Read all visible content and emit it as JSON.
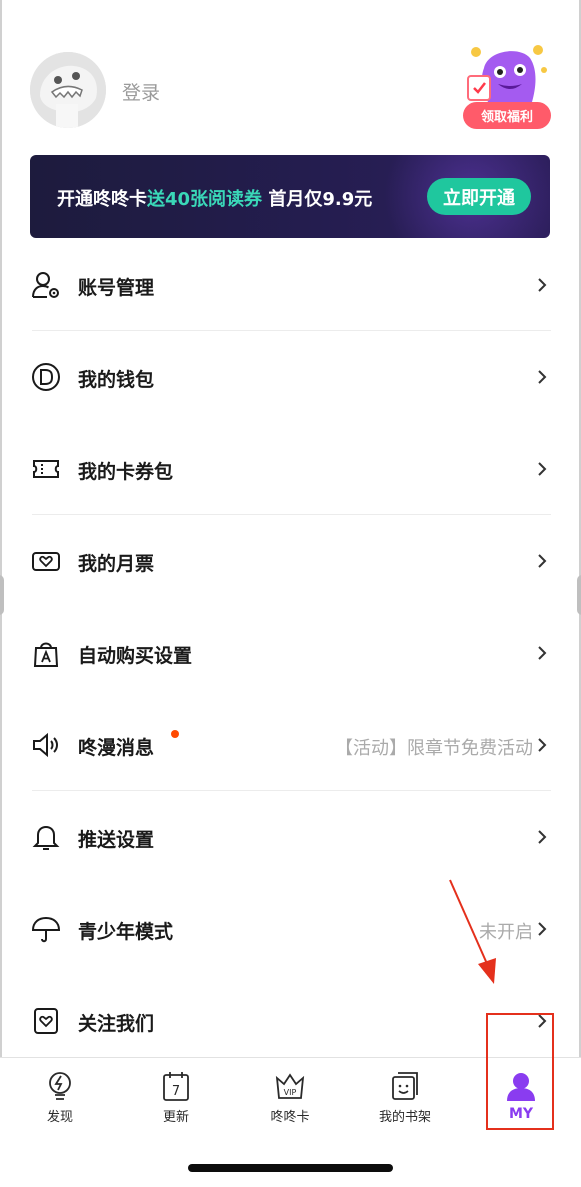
{
  "header": {
    "login_label": "登录",
    "benefit_label": "领取福利"
  },
  "banner": {
    "text_prefix": "开通咚咚卡",
    "text_highlight": "送40张阅读券",
    "text_suffix": " 首月仅9.9元",
    "cta_label": "立即开通",
    "accent_color": "#3ad8b8",
    "button_color": "#1fc79e"
  },
  "menu": {
    "items": [
      {
        "label": "账号管理",
        "icon": "account-settings-icon"
      },
      {
        "label": "我的钱包",
        "icon": "wallet-icon"
      },
      {
        "label": "我的卡券包",
        "icon": "ticket-icon"
      },
      {
        "label": "我的月票",
        "icon": "monthly-ticket-icon"
      },
      {
        "label": "自动购买设置",
        "icon": "shopping-bag-icon"
      },
      {
        "label": "咚漫消息",
        "icon": "speaker-icon",
        "value": "【活动】限章节免费活动",
        "badge_color": "#ff4a00"
      },
      {
        "label": "推送设置",
        "icon": "bell-icon"
      },
      {
        "label": "青少年模式",
        "icon": "umbrella-icon",
        "value": "未开启"
      },
      {
        "label": "关注我们",
        "icon": "heart-frame-icon"
      }
    ]
  },
  "tabbar": {
    "active_color": "#8a3cf0",
    "tabs": [
      {
        "label": "发现",
        "icon": "lightbulb-icon"
      },
      {
        "label": "更新",
        "icon": "calendar-icon",
        "icon_text": "7"
      },
      {
        "label": "咚咚卡",
        "icon": "vip-crown-icon",
        "icon_text": "VIP"
      },
      {
        "label": "我的书架",
        "icon": "bookshelf-icon"
      },
      {
        "label": "MY",
        "icon": "person-icon"
      }
    ]
  },
  "annotation_color": "#e4301c"
}
